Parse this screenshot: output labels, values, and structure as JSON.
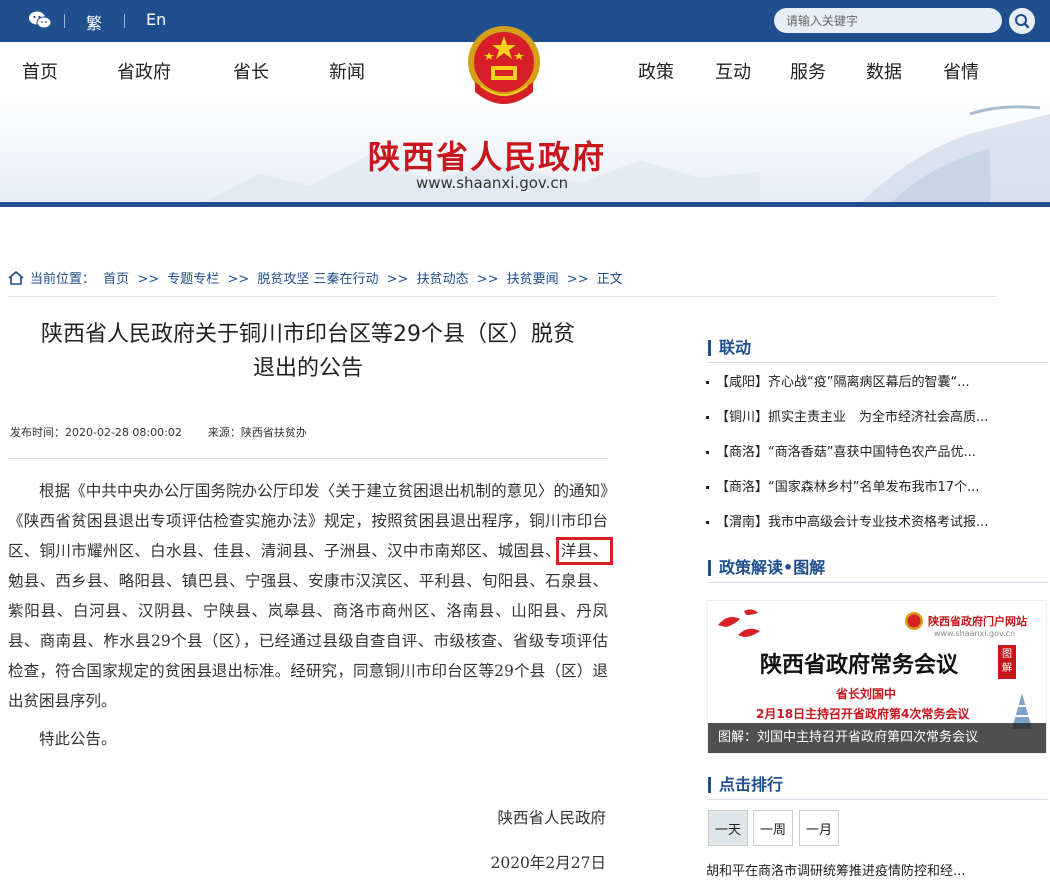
{
  "topbar": {
    "lang_trad": "繁",
    "lang_en": "En",
    "search_placeholder": "请输入关键字"
  },
  "nav": {
    "left": [
      "首页",
      "省政府",
      "省长",
      "新闻"
    ],
    "right": [
      "政策",
      "互动",
      "服务",
      "数据",
      "省情"
    ]
  },
  "banner": {
    "title": "陕西省人民政府",
    "url": "www.shaanxi.gov.cn"
  },
  "breadcrumb": {
    "label": "当前位置：",
    "items": [
      "首页",
      ">>",
      "专题专栏",
      ">>",
      "脱贫攻坚 三秦在行动",
      ">>",
      "扶贫动态",
      ">>",
      "扶贫要闻",
      ">>",
      "正文"
    ]
  },
  "article": {
    "title_line1": "陕西省人民政府关于铜川市印台区等29个县（区）脱贫",
    "title_line2": "退出的公告",
    "meta_time_label": "发布时间：",
    "meta_time": "2020-02-28 08:00:02",
    "meta_source_label": "来源：",
    "meta_source": "陕西省扶贫办",
    "body_before": "根据《中共中央办公厅国务院办公厅印发〈关于建立贫困退出机制的意见〉的通知》《陕西省贫困县退出专项评估检查实施办法》规定，按照贫困县退出程序，铜川市印台区、铜川市耀州区、白水县、佳县、清涧县、子洲县、汉中市南郑区、城固县、",
    "body_highlight": "洋县、",
    "body_after": "勉县、西乡县、略阳县、镇巴县、宁强县、安康市汉滨区、平利县、旬阳县、石泉县、紫阳县、白河县、汉阴县、宁陕县、岚皋县、商洛市商州区、洛南县、山阳县、丹凤县、商南县、柞水县29个县（区），已经通过县级自查自评、市级核查、省级专项评估检查，符合国家规定的贫困县退出标准。经研究，同意铜川市印台区等29个县（区）退出贫困县序列。",
    "notice": "特此公告。",
    "signature": "陕西省人民政府",
    "date": "2020年2月27日"
  },
  "sidebar": {
    "liandong_title": "联动",
    "liandong_items": [
      "【咸阳】齐心战“疫”隔离病区幕后的智囊“...",
      "【铜川】抓实主责主业　为全市经济社会高质...",
      "【商洛】“商洛香菇”喜获中国特色农产品优...",
      "【商洛】“国家森林乡村”名单发布我市17个...",
      "【渭南】我市中高级会计专业技术资格考试报..."
    ],
    "policy_title": "政策解读•图解",
    "pic_logo": "陕西省政府门户网站",
    "pic_logo_url": "www.shaanxi.gov.cn",
    "pic_big": "陕西省政府常务会议",
    "pic_tag": "图解",
    "pic_sub1": "省长刘国中",
    "pic_sub2": "2月18日主持召开省政府第4次常务会议",
    "pic_caption": "图解：刘国中主持召开省政府第四次常务会议",
    "rank_title": "点击排行",
    "rank_tabs": [
      "一天",
      "一周",
      "一月"
    ],
    "rank_first": "胡和平在商洛市调研统筹推进疫情防控和经..."
  }
}
